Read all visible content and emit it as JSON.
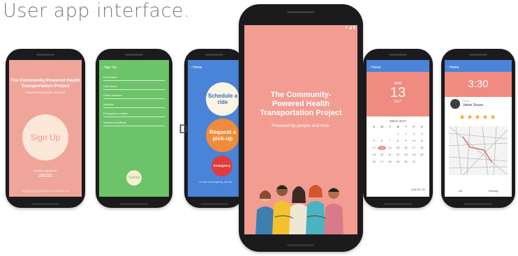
{
  "header": {
    "title": "User app interface",
    "dot": "."
  },
  "phone1": {
    "title": "The Community-Powered Health Transportation Project",
    "subtitle": "Powered by people and love",
    "signup_label": "Sign Up",
    "small_text": "Already registered?",
    "small_link": "Login here",
    "footer": "By signing up you agree to our terms of use"
  },
  "phone2": {
    "appbar": "Sign Up",
    "fields": [
      "First Name",
      "Last Name",
      "Phone Number",
      "Address",
      "Emergency contact",
      "Medical conditions"
    ],
    "submit_label": "Submit"
  },
  "phone3": {
    "appbar": "Home",
    "schedule_label": "Schedule a ride",
    "pickup_label": "Request a pick-up",
    "emergency_label": "Emergency",
    "footer": "In case of emergency, call 911"
  },
  "stray_char": "D",
  "phone4": {
    "title": "The Community-Powered Health Transportation Project",
    "subtitle": "Powered by people and love."
  },
  "phone5": {
    "appbar": "Home",
    "dow": "MAR",
    "day": "13",
    "year": "2017",
    "month": "March 2017",
    "weekdays": [
      "S",
      "M",
      "T",
      "W",
      "T",
      "F",
      "S"
    ],
    "days": [
      "",
      "",
      "",
      "1",
      "2",
      "3",
      "4",
      "5",
      "6",
      "7",
      "8",
      "9",
      "10",
      "11",
      "12",
      "13",
      "14",
      "15",
      "16",
      "17",
      "18",
      "19",
      "20",
      "21",
      "22",
      "23",
      "24",
      "25",
      "26",
      "27",
      "28",
      "29",
      "30",
      "31",
      ""
    ],
    "selected": "13",
    "actions": "CANCEL   OK"
  },
  "phone6": {
    "appbar": "Home",
    "time": "3:30",
    "driver_label": "Driver",
    "driver_name": "Jaime Souza",
    "stars": "★★★★★",
    "call": "Call",
    "message": "Message"
  },
  "colors": {
    "salmon": "#f0a59b",
    "green": "#6cc36a",
    "blue": "#4a84d8",
    "orange": "#f08b3b",
    "red": "#e23b3b",
    "accent_dot": "#2bb5c9"
  }
}
